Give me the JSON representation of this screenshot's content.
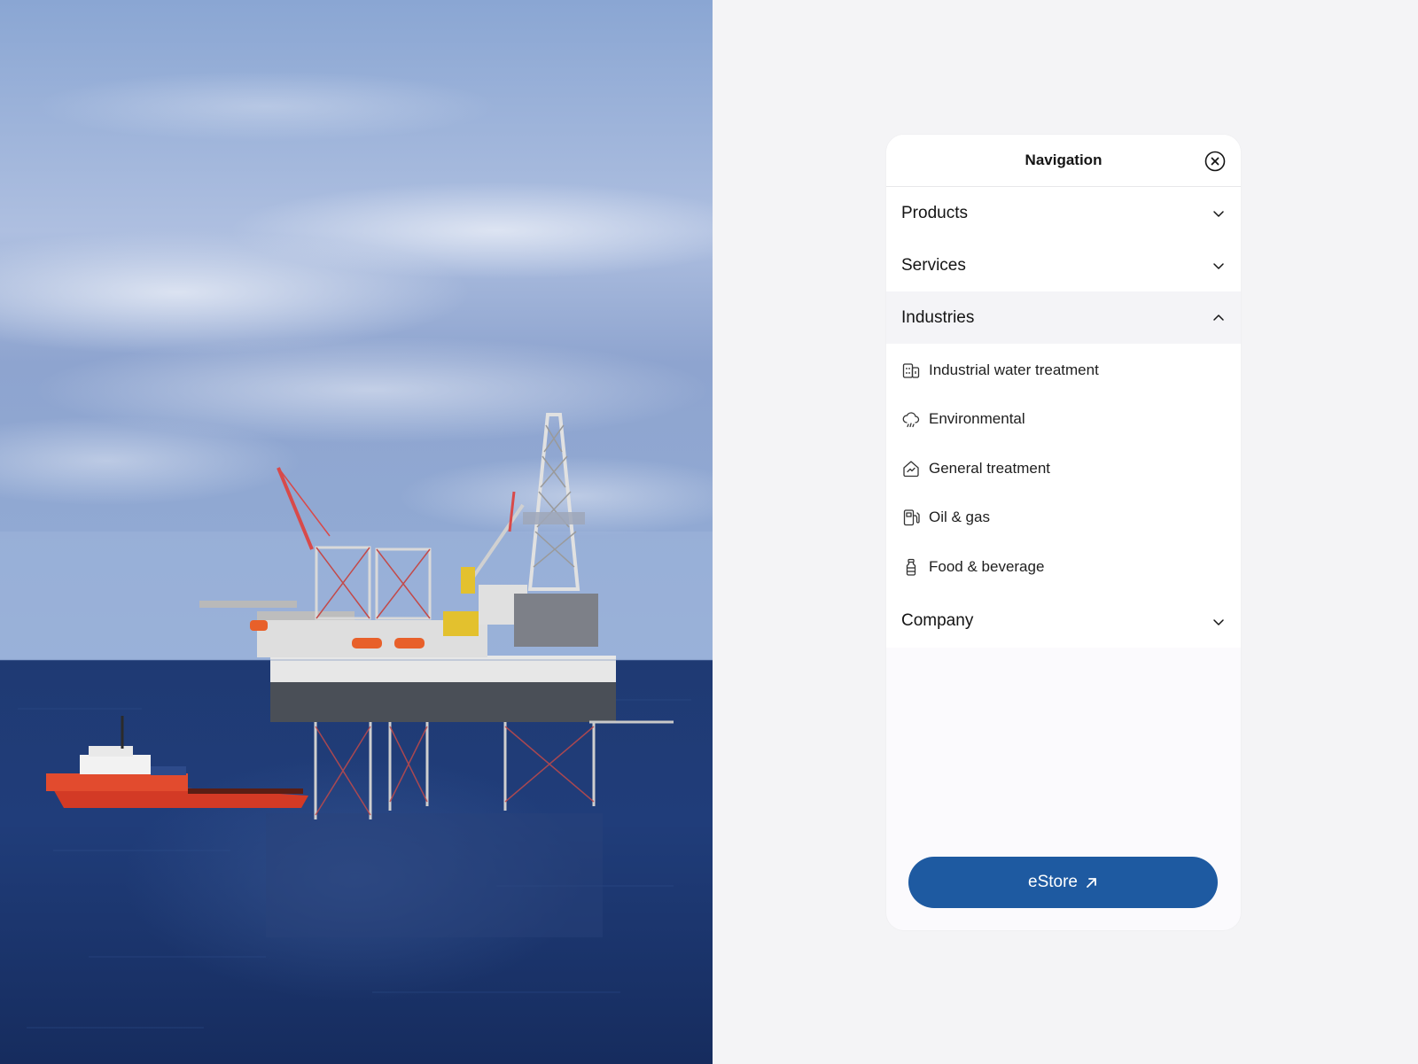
{
  "navigation": {
    "title": "Navigation",
    "close_icon": "close-circle-icon",
    "sections": [
      {
        "label": "Products",
        "expanded": false,
        "icon": "chevron-down-icon"
      },
      {
        "label": "Services",
        "expanded": false,
        "icon": "chevron-down-icon"
      },
      {
        "label": "Industries",
        "expanded": true,
        "icon": "chevron-up-icon",
        "items": [
          {
            "label": "Industrial water treatment",
            "icon": "building-icon"
          },
          {
            "label": "Environmental",
            "icon": "cloud-rain-icon"
          },
          {
            "label": "General treatment",
            "icon": "chart-home-icon"
          },
          {
            "label": "Oil & gas",
            "icon": "fuel-pump-icon"
          },
          {
            "label": "Food & beverage",
            "icon": "bottle-icon"
          }
        ]
      },
      {
        "label": "Company",
        "expanded": false,
        "icon": "chevron-down-icon"
      }
    ],
    "cta": {
      "label": "eStore",
      "icon": "arrow-up-right-icon"
    }
  },
  "colors": {
    "page_bg": "#f4f4f6",
    "panel_bg": "#ffffff",
    "expanded_row_bg": "#f4f4f7",
    "cta_bg": "#1e5aa1",
    "text": "#141414"
  },
  "hero_image": {
    "subject": "offshore-oil-rig-photo"
  }
}
